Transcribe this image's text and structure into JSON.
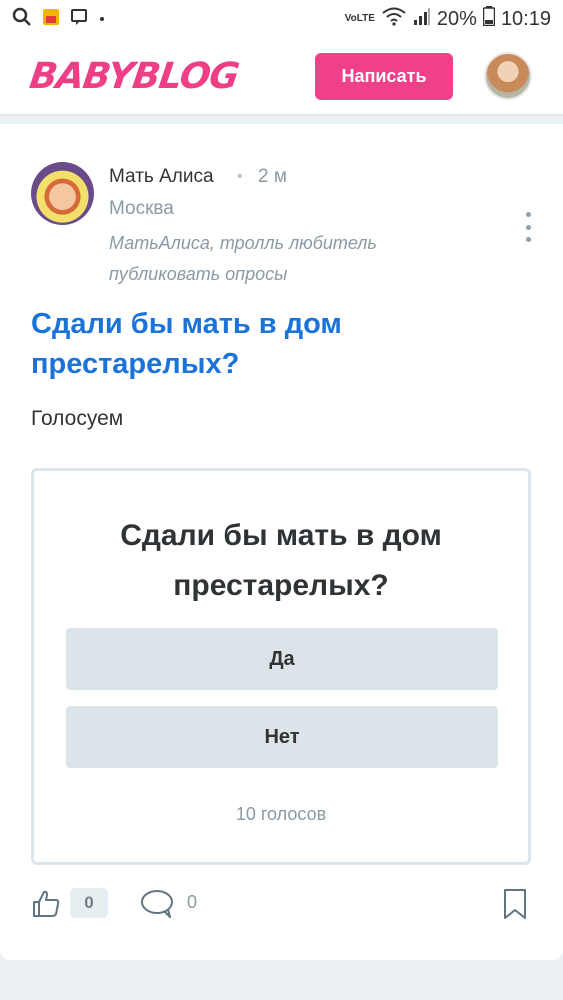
{
  "status_bar": {
    "network": "VoLTE",
    "battery": "20%",
    "time": "10:19"
  },
  "header": {
    "logo": "BABYBLOG",
    "write_button": "Написать"
  },
  "post": {
    "author": "Мать Алиса",
    "time": "2 м",
    "city": "Москва",
    "bio": "МатьАлиса, тролль любитель публиковать опросы",
    "title": "Сдали бы мать в дом престарелых?",
    "text": "Голосуем"
  },
  "poll": {
    "question": "Сдали бы мать в дом престарелых?",
    "options": [
      {
        "label": "Да"
      },
      {
        "label": "Нет"
      }
    ],
    "votes": "10 голосов"
  },
  "actions": {
    "likes": "0",
    "comments": "0"
  },
  "colors": {
    "brand_pink": "#f0408a",
    "title_blue": "#1a73d9",
    "option_bg": "#dbe4e9"
  }
}
